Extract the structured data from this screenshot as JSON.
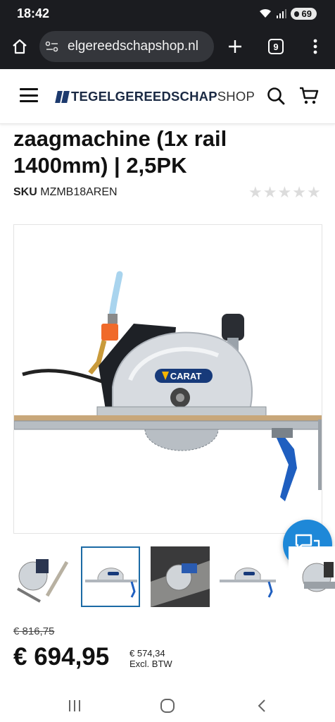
{
  "status_bar": {
    "time": "18:42",
    "battery": "69"
  },
  "browser": {
    "url": "elgereedschapshop.nl",
    "tab_count": "9"
  },
  "header": {
    "logo_strong": "TEGELGEREEDSCHAP",
    "logo_light": "SHOP",
    "brand_color": "#1d3a6e"
  },
  "product": {
    "title": "zaagmachine (1x rail 1400mm) | 2,5PK",
    "sku_label": "SKU",
    "sku": "MZMB18AREN",
    "rating": 0,
    "rating_max": 5,
    "image_brand": "CARAT",
    "old_price": "€ 816,75",
    "price": "€ 694,95",
    "price_excl_value": "€ 574,34",
    "price_excl_label": "Excl. BTW"
  },
  "colors": {
    "accent": "#1b6aa5",
    "chat": "#1e88d8",
    "chrome": "#1b1c20"
  },
  "icons": {
    "home": "home-icon",
    "site_info": "site-info-icon",
    "new_tab": "plus-icon",
    "menu": "more-vert-icon",
    "search": "search-icon",
    "cart": "cart-icon",
    "chat": "chat-icon"
  }
}
